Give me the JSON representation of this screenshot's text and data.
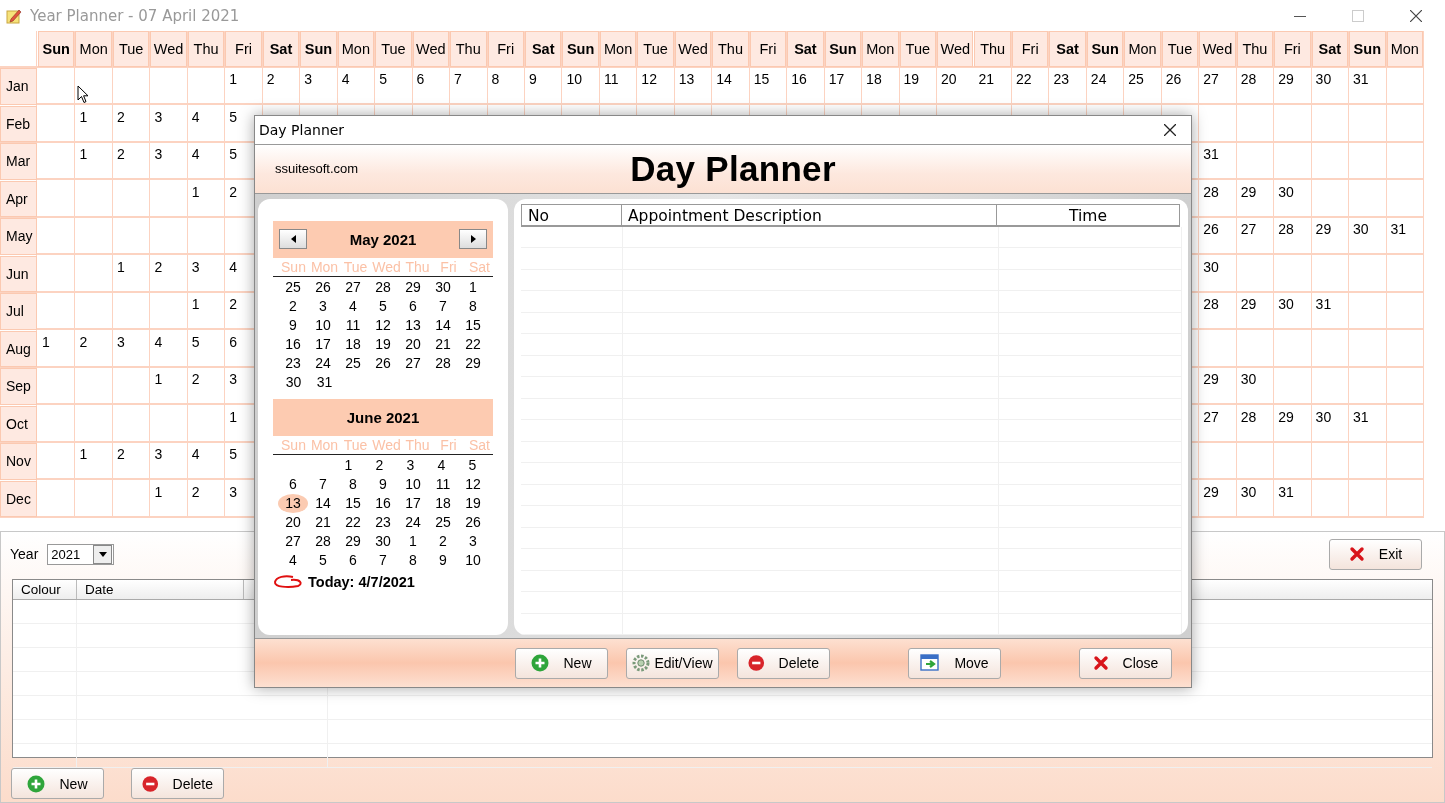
{
  "window": {
    "title": "Year Planner - 07 April 2021"
  },
  "grid": {
    "weekdays": [
      {
        "label": "Sun",
        "weekend": true
      },
      {
        "label": "Mon",
        "weekend": false
      },
      {
        "label": "Tue",
        "weekend": false
      },
      {
        "label": "Wed",
        "weekend": false
      },
      {
        "label": "Thu",
        "weekend": false
      },
      {
        "label": "Fri",
        "weekend": false
      },
      {
        "label": "Sat",
        "weekend": true
      },
      {
        "label": "Sun",
        "weekend": true
      },
      {
        "label": "Mon",
        "weekend": false
      },
      {
        "label": "Tue",
        "weekend": false
      },
      {
        "label": "Wed",
        "weekend": false
      },
      {
        "label": "Thu",
        "weekend": false
      },
      {
        "label": "Fri",
        "weekend": false
      },
      {
        "label": "Sat",
        "weekend": true
      },
      {
        "label": "Sun",
        "weekend": true
      },
      {
        "label": "Mon",
        "weekend": false
      },
      {
        "label": "Tue",
        "weekend": false
      },
      {
        "label": "Wed",
        "weekend": false
      },
      {
        "label": "Thu",
        "weekend": false
      },
      {
        "label": "Fri",
        "weekend": false
      },
      {
        "label": "Sat",
        "weekend": true
      },
      {
        "label": "Sun",
        "weekend": true
      },
      {
        "label": "Mon",
        "weekend": false
      },
      {
        "label": "Tue",
        "weekend": false
      },
      {
        "label": "Wed",
        "weekend": false
      },
      {
        "label": "Thu",
        "weekend": false
      },
      {
        "label": "Fri",
        "weekend": false
      },
      {
        "label": "Sat",
        "weekend": true
      },
      {
        "label": "Sun",
        "weekend": true
      },
      {
        "label": "Mon",
        "weekend": false
      },
      {
        "label": "Tue",
        "weekend": false
      },
      {
        "label": "Wed",
        "weekend": false
      },
      {
        "label": "Thu",
        "weekend": false
      },
      {
        "label": "Fri",
        "weekend": false
      },
      {
        "label": "Sat",
        "weekend": true
      },
      {
        "label": "Sun",
        "weekend": true
      },
      {
        "label": "Mon",
        "weekend": false
      }
    ],
    "months": [
      {
        "name": "Jan",
        "cells": [
          null,
          null,
          null,
          null,
          null,
          "1",
          "2",
          "3",
          "4",
          "5",
          "6",
          "7",
          "8",
          "9",
          "10",
          "11",
          "12",
          "13",
          "14",
          "15",
          "16",
          "17",
          "18",
          "19",
          "20",
          "21",
          "22",
          "23",
          "24",
          "25",
          "26",
          "27",
          "28",
          "29",
          "30",
          "31",
          null
        ]
      },
      {
        "name": "Feb",
        "cells": [
          null,
          "1",
          "2",
          "3",
          "4",
          "5",
          null,
          null,
          null,
          null,
          null,
          null,
          null,
          null,
          null,
          null,
          null,
          null,
          null,
          null,
          null,
          null,
          null,
          null,
          null,
          null,
          null,
          null,
          null,
          null,
          null,
          null,
          null,
          null,
          null,
          null,
          null
        ]
      },
      {
        "name": "Mar",
        "cells": [
          null,
          "1",
          "2",
          "3",
          "4",
          "5",
          null,
          null,
          null,
          null,
          null,
          null,
          null,
          null,
          null,
          null,
          null,
          null,
          null,
          null,
          null,
          null,
          null,
          null,
          null,
          null,
          null,
          null,
          null,
          null,
          null,
          "31",
          null,
          null,
          null,
          null,
          null
        ]
      },
      {
        "name": "Apr",
        "cells": [
          null,
          null,
          null,
          null,
          "1",
          "2",
          null,
          null,
          null,
          null,
          null,
          null,
          null,
          null,
          null,
          null,
          null,
          null,
          null,
          null,
          null,
          null,
          null,
          null,
          null,
          null,
          null,
          null,
          null,
          null,
          null,
          "28",
          "29",
          "30",
          null,
          null,
          null
        ]
      },
      {
        "name": "May",
        "cells": [
          null,
          null,
          null,
          null,
          null,
          null,
          null,
          null,
          null,
          null,
          null,
          null,
          null,
          null,
          null,
          null,
          null,
          null,
          null,
          null,
          null,
          null,
          null,
          null,
          null,
          null,
          null,
          null,
          null,
          null,
          null,
          "26",
          "27",
          "28",
          "29",
          "30",
          "31"
        ]
      },
      {
        "name": "Jun",
        "cells": [
          null,
          null,
          "1",
          "2",
          "3",
          "4",
          null,
          null,
          null,
          null,
          null,
          null,
          null,
          null,
          null,
          null,
          null,
          null,
          null,
          null,
          null,
          null,
          null,
          null,
          null,
          null,
          null,
          null,
          null,
          null,
          null,
          "30",
          null,
          null,
          null,
          null,
          null
        ]
      },
      {
        "name": "Jul",
        "cells": [
          null,
          null,
          null,
          null,
          "1",
          "2",
          null,
          null,
          null,
          null,
          null,
          null,
          null,
          null,
          null,
          null,
          null,
          null,
          null,
          null,
          null,
          null,
          null,
          null,
          null,
          null,
          null,
          null,
          null,
          null,
          null,
          "28",
          "29",
          "30",
          "31",
          null,
          null
        ]
      },
      {
        "name": "Aug",
        "cells": [
          "1",
          "2",
          "3",
          "4",
          "5",
          "6",
          null,
          null,
          null,
          null,
          null,
          null,
          null,
          null,
          null,
          null,
          null,
          null,
          null,
          null,
          null,
          null,
          null,
          null,
          null,
          null,
          null,
          null,
          null,
          null,
          null,
          null,
          null,
          null,
          null,
          null,
          null
        ]
      },
      {
        "name": "Sep",
        "cells": [
          null,
          null,
          null,
          "1",
          "2",
          "3",
          null,
          null,
          null,
          null,
          null,
          null,
          null,
          null,
          null,
          null,
          null,
          null,
          null,
          null,
          null,
          null,
          null,
          null,
          null,
          null,
          null,
          null,
          null,
          null,
          null,
          "29",
          "30",
          null,
          null,
          null,
          null
        ]
      },
      {
        "name": "Oct",
        "cells": [
          null,
          null,
          null,
          null,
          null,
          "1",
          null,
          null,
          null,
          null,
          null,
          null,
          null,
          null,
          null,
          null,
          null,
          null,
          null,
          null,
          null,
          null,
          null,
          null,
          null,
          null,
          null,
          null,
          null,
          null,
          null,
          "27",
          "28",
          "29",
          "30",
          "31",
          null
        ]
      },
      {
        "name": "Nov",
        "cells": [
          null,
          "1",
          "2",
          "3",
          "4",
          "5",
          null,
          null,
          null,
          null,
          null,
          null,
          null,
          null,
          null,
          null,
          null,
          null,
          null,
          null,
          null,
          null,
          null,
          null,
          null,
          null,
          null,
          null,
          null,
          null,
          null,
          null,
          null,
          null,
          null,
          null,
          null
        ]
      },
      {
        "name": "Dec",
        "cells": [
          null,
          null,
          null,
          "1",
          "2",
          "3",
          null,
          null,
          null,
          null,
          null,
          null,
          null,
          null,
          null,
          null,
          null,
          null,
          null,
          null,
          null,
          null,
          null,
          null,
          null,
          null,
          null,
          null,
          null,
          null,
          null,
          "29",
          "30",
          "31",
          null,
          null,
          null
        ]
      }
    ]
  },
  "year_panel": {
    "year_label": "Year",
    "year": "2021",
    "exit_button": "Exit",
    "table": {
      "columns": [
        "Colour",
        "Date"
      ]
    },
    "buttons": [
      {
        "label": "New",
        "kind": "new"
      },
      {
        "label": "Delete",
        "kind": "delete"
      }
    ]
  },
  "day_planner": {
    "title": "Day Planner",
    "website": "ssuitesoft.com",
    "heading": "Day Planner",
    "calendars": [
      {
        "month": "May 2021",
        "nav": true,
        "weekdays": [
          "Sun",
          "Mon",
          "Tue",
          "Wed",
          "Thu",
          "Fri",
          "Sat"
        ],
        "weeks": [
          {
            "days": [
              {
                "d": "25",
                "selected": false
              },
              {
                "d": "26",
                "selected": false
              },
              {
                "d": "27",
                "selected": false
              },
              {
                "d": "28",
                "selected": false
              },
              {
                "d": "29",
                "selected": false
              },
              {
                "d": "30",
                "selected": false
              },
              {
                "d": "1",
                "selected": false
              }
            ]
          },
          {
            "days": [
              {
                "d": "2",
                "selected": false
              },
              {
                "d": "3",
                "selected": false
              },
              {
                "d": "4",
                "selected": false
              },
              {
                "d": "5",
                "selected": false
              },
              {
                "d": "6",
                "selected": false
              },
              {
                "d": "7",
                "selected": false
              },
              {
                "d": "8",
                "selected": false
              }
            ]
          },
          {
            "days": [
              {
                "d": "9",
                "selected": false
              },
              {
                "d": "10",
                "selected": false
              },
              {
                "d": "11",
                "selected": false
              },
              {
                "d": "12",
                "selected": false
              },
              {
                "d": "13",
                "selected": false
              },
              {
                "d": "14",
                "selected": false
              },
              {
                "d": "15",
                "selected": false
              }
            ]
          },
          {
            "days": [
              {
                "d": "16",
                "selected": false
              },
              {
                "d": "17",
                "selected": false
              },
              {
                "d": "18",
                "selected": false
              },
              {
                "d": "19",
                "selected": false
              },
              {
                "d": "20",
                "selected": false
              },
              {
                "d": "21",
                "selected": false
              },
              {
                "d": "22",
                "selected": false
              }
            ]
          },
          {
            "days": [
              {
                "d": "23",
                "selected": false
              },
              {
                "d": "24",
                "selected": false
              },
              {
                "d": "25",
                "selected": false
              },
              {
                "d": "26",
                "selected": false
              },
              {
                "d": "27",
                "selected": false
              },
              {
                "d": "28",
                "selected": false
              },
              {
                "d": "29",
                "selected": false
              }
            ]
          },
          {
            "right_aligned": false,
            "days": [
              {
                "d": "30",
                "selected": false
              },
              {
                "d": "31",
                "selected": false
              }
            ]
          }
        ]
      },
      {
        "month": "June 2021",
        "nav": false,
        "weekdays": [
          "Sun",
          "Mon",
          "Tue",
          "Wed",
          "Thu",
          "Fri",
          "Sat"
        ],
        "weeks": [
          {
            "right_aligned": true,
            "days": [
              {
                "d": "1",
                "selected": false
              },
              {
                "d": "2",
                "selected": false
              },
              {
                "d": "3",
                "selected": false
              },
              {
                "d": "4",
                "selected": false
              },
              {
                "d": "5",
                "selected": false
              }
            ]
          },
          {
            "days": [
              {
                "d": "6",
                "selected": false
              },
              {
                "d": "7",
                "selected": false
              },
              {
                "d": "8",
                "selected": false
              },
              {
                "d": "9",
                "selected": false
              },
              {
                "d": "10",
                "selected": false
              },
              {
                "d": "11",
                "selected": false
              },
              {
                "d": "12",
                "selected": false
              }
            ]
          },
          {
            "days": [
              {
                "d": "13",
                "selected": true
              },
              {
                "d": "14",
                "selected": false
              },
              {
                "d": "15",
                "selected": false
              },
              {
                "d": "16",
                "selected": false
              },
              {
                "d": "17",
                "selected": false
              },
              {
                "d": "18",
                "selected": false
              },
              {
                "d": "19",
                "selected": false
              }
            ]
          },
          {
            "days": [
              {
                "d": "20",
                "selected": false
              },
              {
                "d": "21",
                "selected": false
              },
              {
                "d": "22",
                "selected": false
              },
              {
                "d": "23",
                "selected": false
              },
              {
                "d": "24",
                "selected": false
              },
              {
                "d": "25",
                "selected": false
              },
              {
                "d": "26",
                "selected": false
              }
            ]
          },
          {
            "days": [
              {
                "d": "27",
                "selected": false
              },
              {
                "d": "28",
                "selected": false
              },
              {
                "d": "29",
                "selected": false
              },
              {
                "d": "30",
                "selected": false
              },
              {
                "d": "1",
                "selected": false
              },
              {
                "d": "2",
                "selected": false
              },
              {
                "d": "3",
                "selected": false
              }
            ]
          },
          {
            "days": [
              {
                "d": "4",
                "selected": false
              },
              {
                "d": "5",
                "selected": false
              },
              {
                "d": "6",
                "selected": false
              },
              {
                "d": "7",
                "selected": false
              },
              {
                "d": "8",
                "selected": false
              },
              {
                "d": "9",
                "selected": false
              },
              {
                "d": "10",
                "selected": false
              }
            ]
          }
        ]
      }
    ],
    "today": "Today: 4/7/2021",
    "table": {
      "columns": [
        "No",
        "Appointment Description",
        "Time"
      ]
    },
    "buttons": [
      {
        "label": "New",
        "kind": "new"
      },
      {
        "label": "Edit/View",
        "kind": "edit"
      },
      {
        "label": "Delete",
        "kind": "delete"
      },
      {
        "label": "Move",
        "kind": "move"
      },
      {
        "label": "Close",
        "kind": "close"
      }
    ]
  }
}
